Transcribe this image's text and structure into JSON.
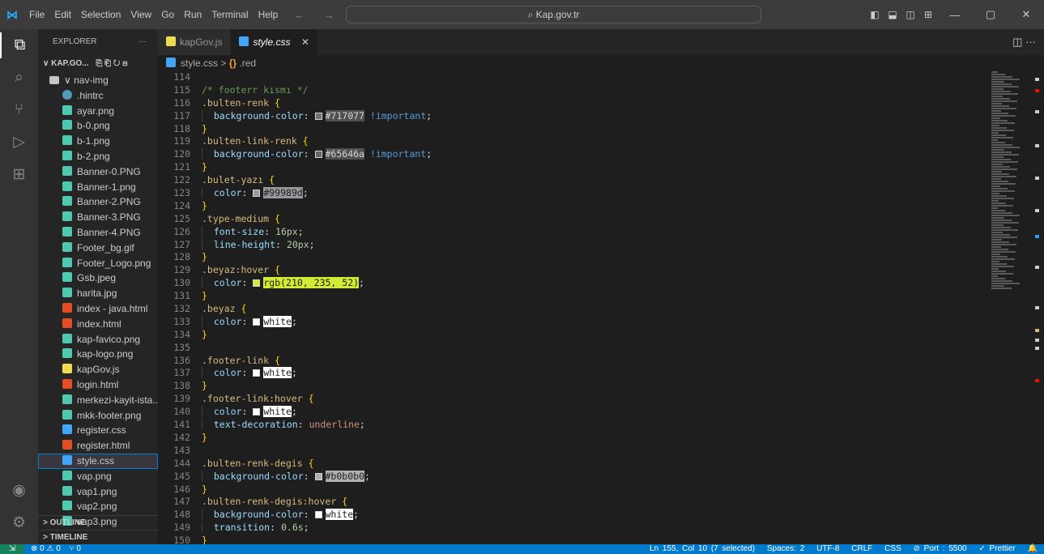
{
  "titlebar": {
    "menu": [
      "File",
      "Edit",
      "Selection",
      "View",
      "Go",
      "Run",
      "Terminal",
      "Help"
    ],
    "nav_arrows": "← →",
    "search_text": "⌕ Kap.gov.tr",
    "layout_icons": [
      "◧",
      "⬓",
      "◫",
      "⊞"
    ],
    "window_buttons": [
      "—",
      "▢",
      "✕"
    ]
  },
  "activity_bar": {
    "top_icons": [
      "explorer-icon",
      "search-icon",
      "source-control-icon",
      "run-debug-icon",
      "extensions-icon"
    ],
    "bottom_icons": [
      "account-icon",
      "settings-gear-icon"
    ]
  },
  "explorer": {
    "title": "EXPLORER",
    "title_more": "···",
    "root_label": "∨ KAP.GO...",
    "root_actions": "⎘ ⎗ ↻ ⊟",
    "folder": "∨ nav-img",
    "files": [
      {
        "name": ".hintrc",
        "type": "rc"
      },
      {
        "name": "ayar.png",
        "type": "png"
      },
      {
        "name": "b-0.png",
        "type": "png"
      },
      {
        "name": "b-1.png",
        "type": "png"
      },
      {
        "name": "b-2.png",
        "type": "png"
      },
      {
        "name": "Banner-0.PNG",
        "type": "png"
      },
      {
        "name": "Banner-1.png",
        "type": "png"
      },
      {
        "name": "Banner-2.PNG",
        "type": "png"
      },
      {
        "name": "Banner-3.PNG",
        "type": "png"
      },
      {
        "name": "Banner-4.PNG",
        "type": "png"
      },
      {
        "name": "Footer_bg.gif",
        "type": "png"
      },
      {
        "name": "Footer_Logo.png",
        "type": "png"
      },
      {
        "name": "Gsb.jpeg",
        "type": "png"
      },
      {
        "name": "harita.jpg",
        "type": "png"
      },
      {
        "name": "index - java.html",
        "type": "html"
      },
      {
        "name": "index.html",
        "type": "html"
      },
      {
        "name": "kap-favico.png",
        "type": "png"
      },
      {
        "name": "kap-logo.png",
        "type": "png"
      },
      {
        "name": "kapGov.js",
        "type": "js"
      },
      {
        "name": "login.html",
        "type": "html"
      },
      {
        "name": "merkezi-kayit-ista...",
        "type": "png"
      },
      {
        "name": "mkk-footer.png",
        "type": "png"
      },
      {
        "name": "register.css",
        "type": "css"
      },
      {
        "name": "register.html",
        "type": "html"
      },
      {
        "name": "style.css",
        "type": "css",
        "selected": true
      },
      {
        "name": "vap.png",
        "type": "png"
      },
      {
        "name": "vap1.png",
        "type": "png"
      },
      {
        "name": "vap2.png",
        "type": "png"
      },
      {
        "name": "vap3.png",
        "type": "png"
      }
    ],
    "outline": "> OUTLINE",
    "timeline": "> TIMELINE"
  },
  "tabs": [
    {
      "label": "kapGov.js",
      "active": false,
      "icon": "js"
    },
    {
      "label": "style.css",
      "active": true,
      "icon": "css",
      "close": "✕"
    }
  ],
  "tabs_right": "◫ ···",
  "breadcrumb": {
    "file": "style.css",
    "separator": ">",
    "symbol_icon": "{}",
    "symbol": ".red"
  },
  "code": [
    {
      "n": "114",
      "t": ""
    },
    {
      "n": "115",
      "t": "/* footerr kısmı */"
    },
    {
      "n": "116",
      "t": ".bulten-renk {"
    },
    {
      "n": "117",
      "t": "  background-color: #717077 !important;"
    },
    {
      "n": "118",
      "t": "}"
    },
    {
      "n": "119",
      "t": ".bulten-link-renk {"
    },
    {
      "n": "120",
      "t": "  background-color: #65646a !important;"
    },
    {
      "n": "121",
      "t": "}"
    },
    {
      "n": "122",
      "t": ".bulet-yazı {"
    },
    {
      "n": "123",
      "t": "  color: #99989d;"
    },
    {
      "n": "124",
      "t": "}"
    },
    {
      "n": "125",
      "t": ".type-medium {"
    },
    {
      "n": "126",
      "t": "  font-size: 16px;"
    },
    {
      "n": "127",
      "t": "  line-height: 20px;"
    },
    {
      "n": "128",
      "t": "}"
    },
    {
      "n": "129",
      "t": ".beyaz:hover {"
    },
    {
      "n": "130",
      "t": "  color: rgb(210, 235, 52);"
    },
    {
      "n": "131",
      "t": "}"
    },
    {
      "n": "132",
      "t": ".beyaz {"
    },
    {
      "n": "133",
      "t": "  color: white;"
    },
    {
      "n": "134",
      "t": "}"
    },
    {
      "n": "135",
      "t": ""
    },
    {
      "n": "136",
      "t": ".footer-link {"
    },
    {
      "n": "137",
      "t": "  color: white;"
    },
    {
      "n": "138",
      "t": "}"
    },
    {
      "n": "139",
      "t": ".footer-link:hover {"
    },
    {
      "n": "140",
      "t": "  color: white;"
    },
    {
      "n": "141",
      "t": "  text-decoration: underline;"
    },
    {
      "n": "142",
      "t": "}"
    },
    {
      "n": "143",
      "t": ""
    },
    {
      "n": "144",
      "t": ".bulten-renk-degis {"
    },
    {
      "n": "145",
      "t": "  background-color: #b0b0b0;"
    },
    {
      "n": "146",
      "t": "}"
    },
    {
      "n": "147",
      "t": ".bulten-renk-degis:hover {"
    },
    {
      "n": "148",
      "t": "  background-color: white;"
    },
    {
      "n": "149",
      "t": "  transition: 0.6s;"
    },
    {
      "n": "150",
      "t": "}"
    }
  ],
  "statusbar": {
    "remote": "⇲",
    "problems": "⊗ 0 ⚠ 0",
    "ports": "⑂ 0",
    "position": "Ln 155, Col 10 (7 selected)",
    "spaces": "Spaces: 2",
    "encoding": "UTF-8",
    "eol": "CRLF",
    "language": "CSS",
    "port": "⊘ Port : 5500",
    "prettier": "✓ Prettier",
    "bell": "🔔"
  },
  "colors": {
    "statusbar": "#007acc",
    "selection_border": "#007fd4",
    "swatch_717077": "#717077",
    "swatch_65646a": "#65646a",
    "swatch_99989d": "#99989d",
    "swatch_d2eb34": "#d2eb34",
    "swatch_b0b0b0": "#b0b0b0"
  }
}
